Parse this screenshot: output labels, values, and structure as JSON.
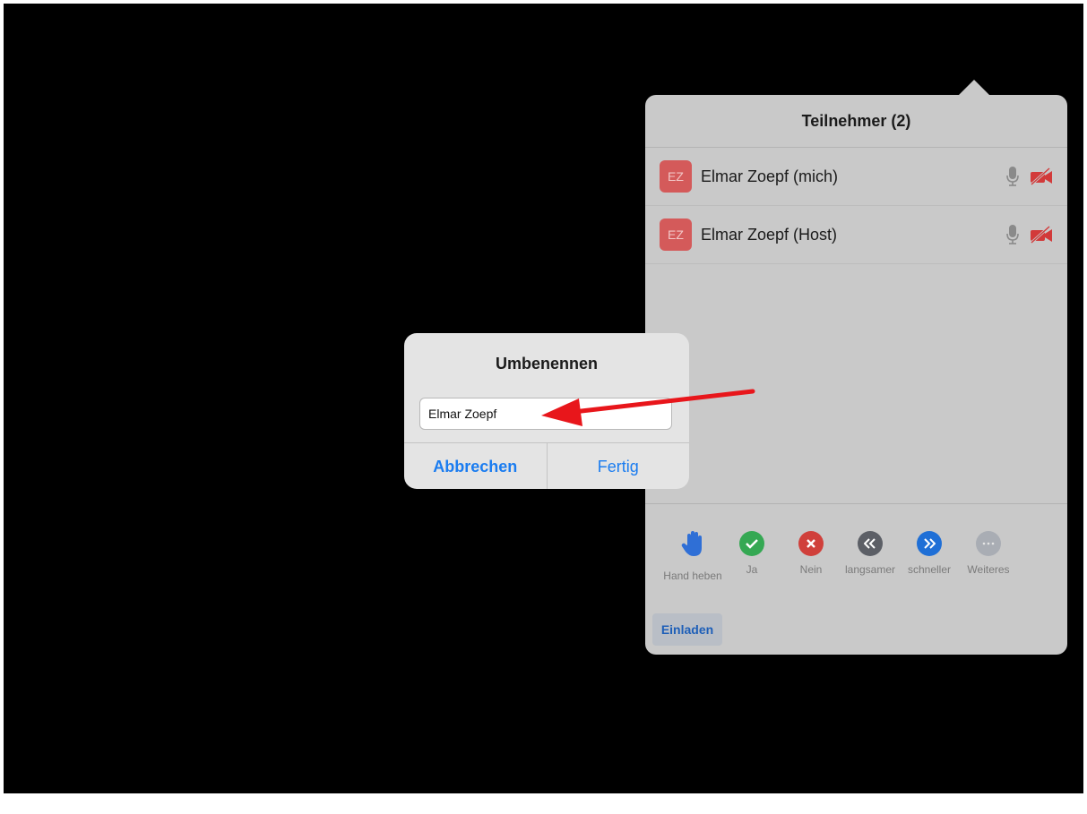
{
  "participants_panel": {
    "title": "Teilnehmer (2)",
    "participants": [
      {
        "initials": "EZ",
        "name": "Elmar Zoepf (mich)"
      },
      {
        "initials": "EZ",
        "name": "Elmar Zoepf (Host)"
      }
    ],
    "reactions": [
      {
        "icon": "raised-hand-icon",
        "label": "Hand heben",
        "color": "#2f6fd6"
      },
      {
        "icon": "check-icon",
        "label": "Ja",
        "color": "#35a853"
      },
      {
        "icon": "x-icon",
        "label": "Nein",
        "color": "#d0403b"
      },
      {
        "icon": "rewind-icon",
        "label": "langsamer",
        "color": "#5c5f66"
      },
      {
        "icon": "fast-forward-icon",
        "label": "schneller",
        "color": "#1f6fd6"
      },
      {
        "icon": "more-icon",
        "label": "Weiteres",
        "color": "#a9adb4"
      }
    ],
    "invite_label": "Einladen"
  },
  "rename_dialog": {
    "title": "Umbenennen",
    "input_value": "Elmar Zoepf",
    "cancel_label": "Abbrechen",
    "confirm_label": "Fertig"
  },
  "colors": {
    "accent": "#1a7cf0",
    "annotation_arrow": "#e8161b",
    "avatar": "#d45a5a"
  }
}
